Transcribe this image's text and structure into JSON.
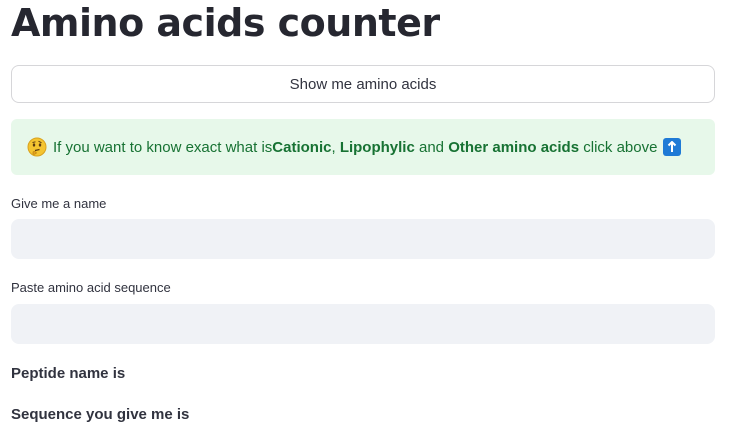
{
  "page": {
    "title": "Amino acids counter"
  },
  "button": {
    "label": "Show me amino acids"
  },
  "info": {
    "prefix": "If you want to know exact what is ",
    "cationic": "Cationic",
    "comma": ", ",
    "lipophylic": "Lipophylic",
    "and": " and ",
    "other": "Other amino acids",
    "suffix": " click above",
    "icons": [
      "thinking-face-emoji",
      "up-arrow-box-emoji"
    ],
    "colors": {
      "background": "#e7f8ea",
      "text": "#177233",
      "arrow_box": "#1f7ad6"
    }
  },
  "form": {
    "name_label": "Give me a name",
    "name_value": "",
    "sequence_label": "Paste amino acid sequence",
    "sequence_value": ""
  },
  "results": {
    "peptide_name": "Peptide name is",
    "sequence": "Sequence you give me is"
  }
}
